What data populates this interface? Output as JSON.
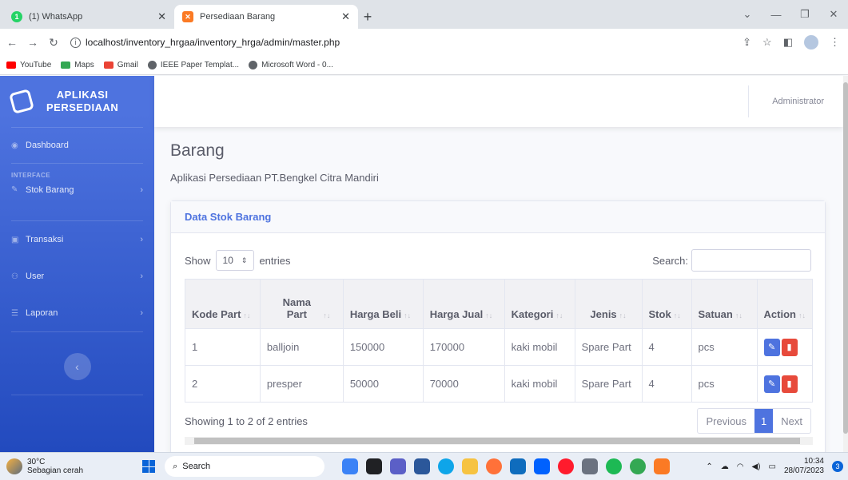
{
  "browser": {
    "tabs": [
      {
        "label": "(1) WhatsApp",
        "icon": "whatsapp-icon",
        "color": "#25d366"
      },
      {
        "label": "Persediaan Barang",
        "icon": "xampp-icon",
        "color": "#fb7a24"
      }
    ],
    "url": "localhost/inventory_hrgaa/inventory_hrga/admin/master.php",
    "bookmarks": [
      "YouTube",
      "Maps",
      "Gmail",
      "IEEE Paper Templat...",
      "Microsoft Word - 0..."
    ]
  },
  "app": {
    "brand_line1": "APLIKASI",
    "brand_line2": "PERSEDIAAN",
    "user_name": "Administrator",
    "accent": "#4e73df"
  },
  "sidebar": {
    "dashboard": "Dashboard",
    "heading": "INTERFACE",
    "items": [
      {
        "label": "Stok Barang",
        "icon": "wrench-icon"
      },
      {
        "label": "Transaksi",
        "icon": "truck-icon"
      },
      {
        "label": "User",
        "icon": "users-icon"
      },
      {
        "label": "Laporan",
        "icon": "list-icon"
      }
    ]
  },
  "page": {
    "title": "Barang",
    "subtitle": "Aplikasi Persediaan PT.Bengkel Citra Mandiri",
    "card_title": "Data Stok Barang"
  },
  "datatable": {
    "show_label": "Show",
    "entries_value": "10",
    "entries_label": "entries",
    "search_label": "Search:",
    "columns": [
      "Kode Part",
      "Nama Part",
      "Harga Beli",
      "Harga Jual",
      "Kategori",
      "Jenis",
      "Stok",
      "Satuan",
      "Action"
    ],
    "rows": [
      [
        "1",
        "balljoin",
        "150000",
        "170000",
        "kaki mobil",
        "Spare Part",
        "4",
        "pcs"
      ],
      [
        "2",
        "presper",
        "50000",
        "70000",
        "kaki mobil",
        "Spare Part",
        "4",
        "pcs"
      ]
    ],
    "info": "Showing 1 to 2 of 2 entries",
    "prev": "Previous",
    "page": "1",
    "next": "Next"
  },
  "taskbar": {
    "temp": "30°C",
    "weather": "Sebagian cerah",
    "search": "Search",
    "time": "10:34",
    "date": "28/07/2023",
    "notif_count": "3"
  }
}
